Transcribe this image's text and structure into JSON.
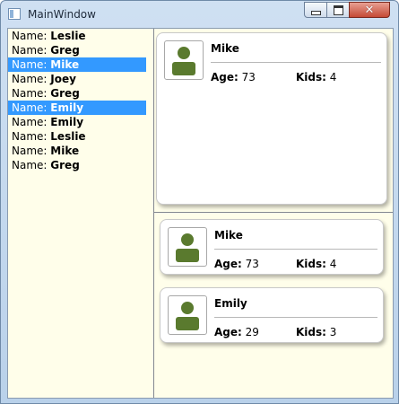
{
  "window": {
    "title": "MainWindow",
    "buttons": {
      "minimize": "minimize",
      "maximize": "maximize",
      "close": "close"
    }
  },
  "list": {
    "prefix": "Name:",
    "items": [
      {
        "name": "Leslie",
        "selected": false
      },
      {
        "name": "Greg",
        "selected": false
      },
      {
        "name": "Mike",
        "selected": true
      },
      {
        "name": "Joey",
        "selected": false
      },
      {
        "name": "Greg",
        "selected": false
      },
      {
        "name": "Emily",
        "selected": true
      },
      {
        "name": "Emily",
        "selected": false
      },
      {
        "name": "Leslie",
        "selected": false
      },
      {
        "name": "Mike",
        "selected": false
      },
      {
        "name": "Greg",
        "selected": false
      }
    ]
  },
  "labels": {
    "age": "Age:",
    "kids": "Kids:"
  },
  "detail": {
    "name": "Mike",
    "age": "73",
    "kids": "4"
  },
  "cards": [
    {
      "name": "Mike",
      "age": "73",
      "kids": "4"
    },
    {
      "name": "Emily",
      "age": "29",
      "kids": "3"
    }
  ],
  "colors": {
    "selection": "#3399ff",
    "background": "#fffeea",
    "avatar": "#5a7a2e"
  }
}
